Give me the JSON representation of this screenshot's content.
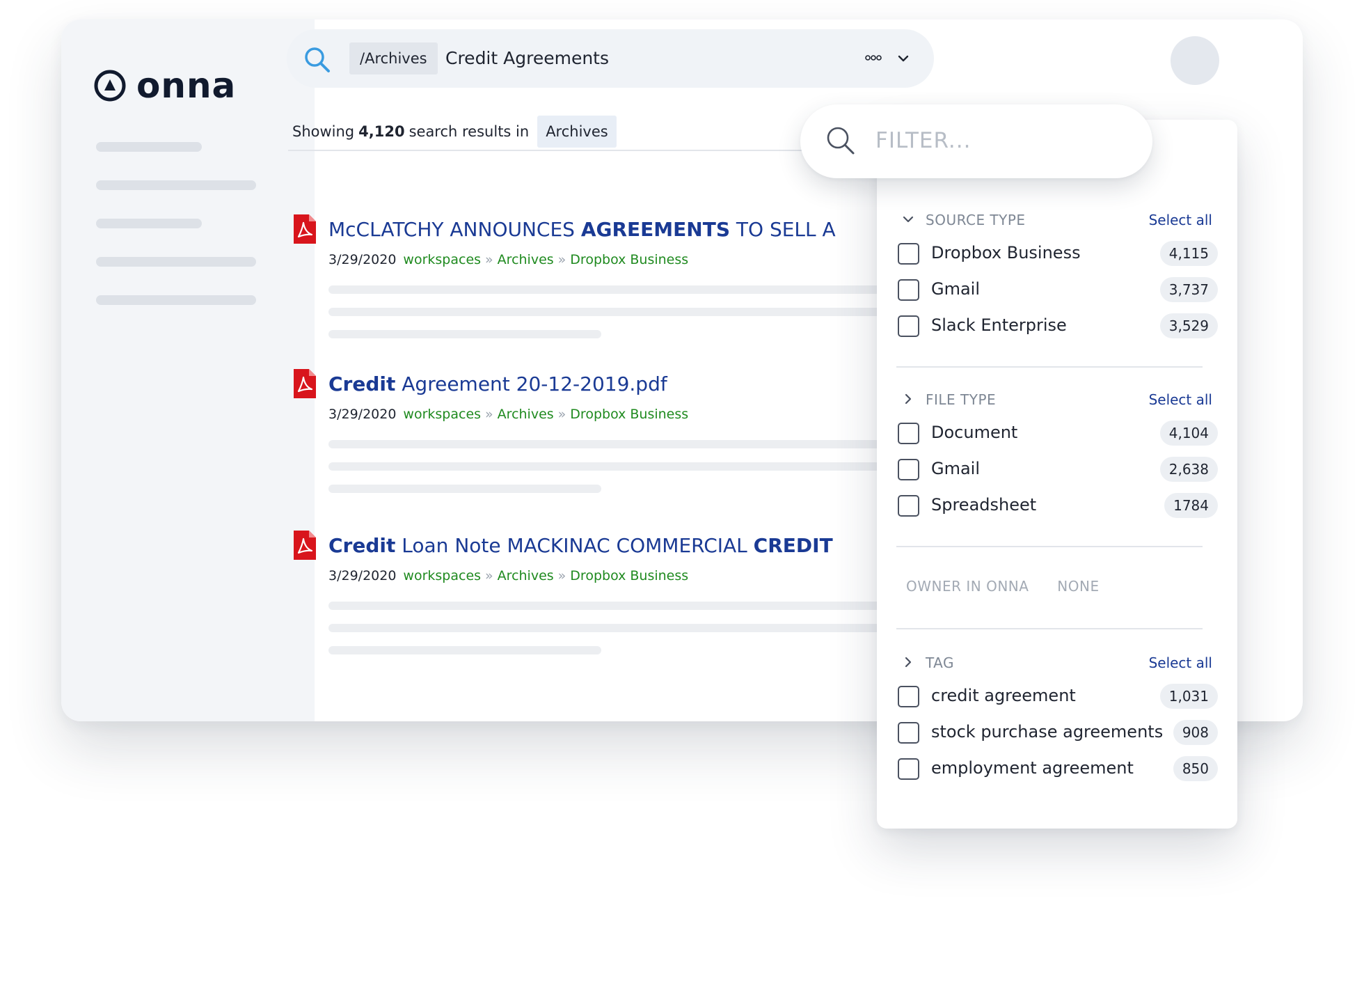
{
  "app": {
    "logo_text": "onna"
  },
  "search": {
    "scope": "/Archives",
    "query": "Credit Agreements"
  },
  "results_header": {
    "prefix": "Showing",
    "count": "4,120",
    "middle": "search results in",
    "scope": "Archives"
  },
  "results": [
    {
      "title_parts": [
        {
          "text": "McCLATCHY ANNOUNCES ",
          "bold": false
        },
        {
          "text": "AGREEMENTS",
          "bold": true
        },
        {
          "text": " TO SELL A",
          "bold": false
        }
      ],
      "date": "3/29/2020",
      "path": [
        "workspaces",
        "Archives",
        "Dropbox Business"
      ]
    },
    {
      "title_parts": [
        {
          "text": "Credit",
          "bold": true
        },
        {
          "text": " Agreement 20-12-2019.pdf",
          "bold": false
        }
      ],
      "date": "3/29/2020",
      "path": [
        "workspaces",
        "Archives",
        "Dropbox Business"
      ]
    },
    {
      "title_parts": [
        {
          "text": "Credit",
          "bold": true
        },
        {
          "text": " Loan Note MACKINAC COMMERCIAL ",
          "bold": false
        },
        {
          "text": "CREDIT",
          "bold": true
        }
      ],
      "date": "3/29/2020",
      "path": [
        "workspaces",
        "Archives",
        "Dropbox Business"
      ]
    }
  ],
  "path_separator": "»",
  "filter": {
    "placeholder": "FILTER...",
    "sections": [
      {
        "title": "SOURCE TYPE",
        "expanded": true,
        "select_all": "Select all",
        "options": [
          {
            "label": "Dropbox Business",
            "count": "4,115"
          },
          {
            "label": "Gmail",
            "count": "3,737"
          },
          {
            "label": "Slack Enterprise",
            "count": "3,529"
          }
        ]
      },
      {
        "title": "FILE TYPE",
        "expanded": false,
        "select_all": "Select all",
        "options": [
          {
            "label": "Document",
            "count": "4,104"
          },
          {
            "label": "Gmail",
            "count": "2,638"
          },
          {
            "label": "Spreadsheet",
            "count": "1784"
          }
        ]
      },
      {
        "title": "TAG",
        "expanded": false,
        "select_all": "Select all",
        "options": [
          {
            "label": "credit agreement",
            "count": "1,031"
          },
          {
            "label": "stock purchase agreements",
            "count": "908"
          },
          {
            "label": "employment agreement",
            "count": "850"
          }
        ]
      }
    ],
    "owner": {
      "label": "OWNER IN ONNA",
      "value": "NONE"
    }
  },
  "colors": {
    "title_blue": "#1a3a94",
    "path_green": "#1f8a1f",
    "pdf_red": "#d8151c",
    "accent_search": "#3a9be0"
  },
  "icons": {
    "search": "search-icon",
    "more": "more-icon",
    "dropdown": "chevron-down-icon",
    "add": "plus-circle-icon",
    "pdf": "pdf-file-icon",
    "expand": "chevron-right-icon"
  }
}
